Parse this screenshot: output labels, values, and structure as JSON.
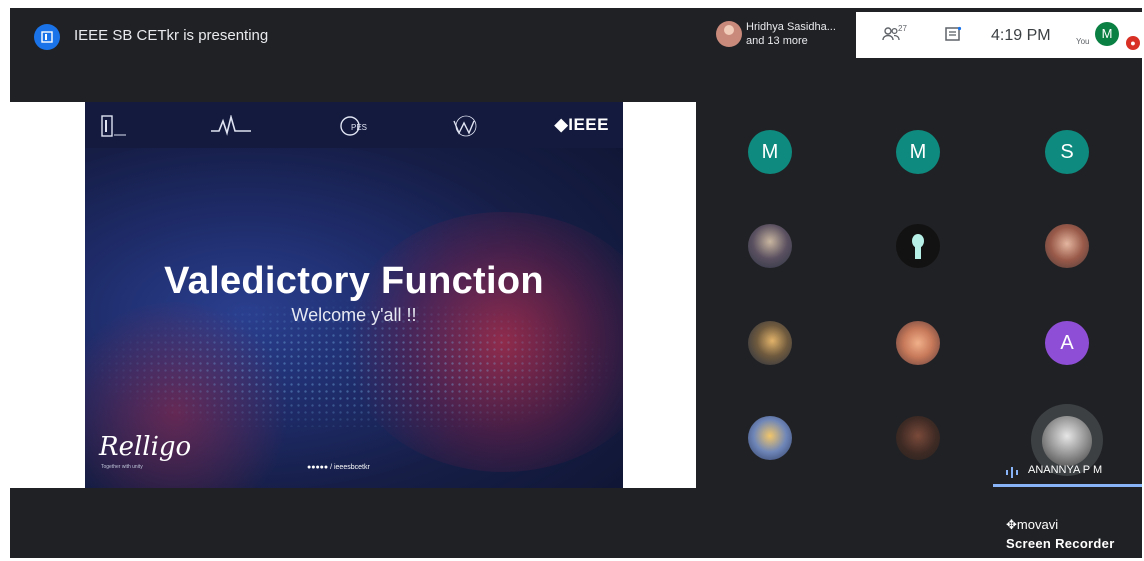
{
  "header": {
    "presenting_text": "IEEE SB CETkr is presenting",
    "participants_names_line1": "Hridhya Sasidha...",
    "participants_names_line2": "and 13 more",
    "people_count": "27",
    "time": "4:19 PM",
    "self_label": "You",
    "self_initial": "M"
  },
  "slide": {
    "title": "Valedictory Function",
    "subtitle": "Welcome y'all !!",
    "brand": "Relligo",
    "brand_tagline": "Together with unity",
    "footer_handle": "/ ieeesbcetkr",
    "ieee_logo": "◆IEEE",
    "logos": [
      "logo-1",
      "logo-2",
      "logo-3",
      "logo-4"
    ]
  },
  "grid": {
    "initials": [
      {
        "letter": "M",
        "color": "#0f8a7e"
      },
      {
        "letter": "M",
        "color": "#0f8a7e"
      },
      {
        "letter": "S",
        "color": "#0f8a7e"
      },
      {
        "letter": "A",
        "color": "#8e4fd6"
      }
    ],
    "active_speaker": "ANANNYA P M"
  },
  "watermark": {
    "brand": "movavi",
    "text": "Screen Recorder"
  }
}
